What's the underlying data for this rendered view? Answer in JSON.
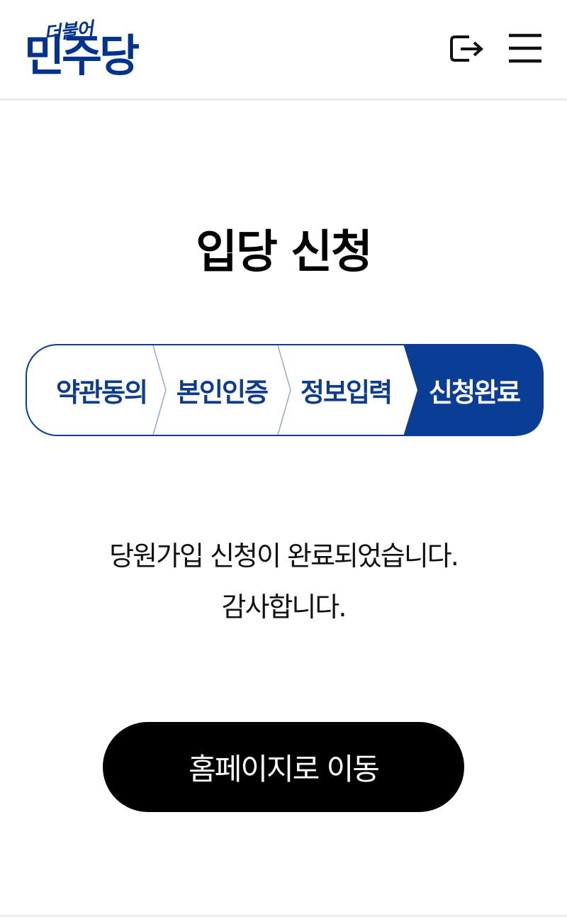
{
  "header": {
    "logo_small": "더불어",
    "logo_big": "민주당",
    "logout_icon": "logout-icon",
    "menu_icon": "hamburger-menu-icon"
  },
  "main": {
    "title": "입당 신청",
    "steps": [
      {
        "label": "약관동의",
        "active": false
      },
      {
        "label": "본인인증",
        "active": false
      },
      {
        "label": "정보입력",
        "active": false
      },
      {
        "label": "신청완료",
        "active": true
      }
    ],
    "message_line1": "당원가입 신청이 완료되었습니다.",
    "message_line2": "감사합니다.",
    "home_button_label": "홈페이지로 이동"
  },
  "colors": {
    "brand": "#00338f",
    "step_active_bg": "#0a3d96",
    "step_border": "#0a3d96",
    "button_bg": "#000000"
  }
}
